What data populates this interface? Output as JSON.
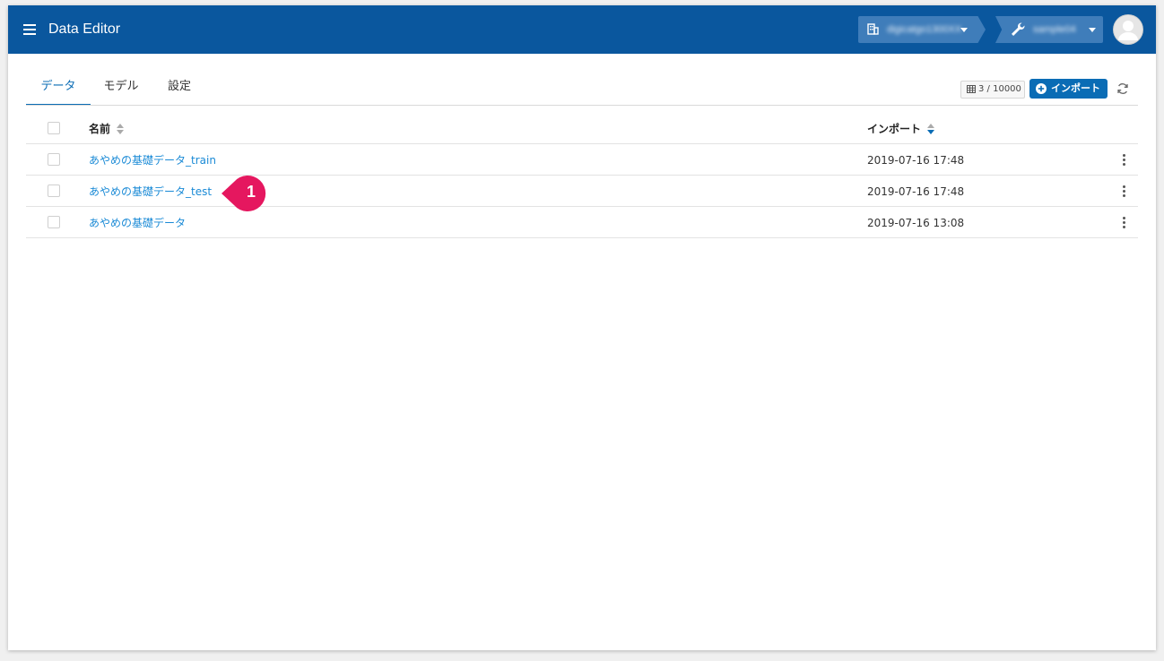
{
  "app": {
    "title": "Data Editor"
  },
  "header": {
    "organization": "digicatgo1300XX",
    "project": "sample04"
  },
  "tabs": [
    {
      "label": "データ",
      "active": true
    },
    {
      "label": "モデル",
      "active": false
    },
    {
      "label": "設定",
      "active": false
    }
  ],
  "toolbar": {
    "count": "3 / 10000",
    "import_label": "インポート"
  },
  "table": {
    "columns": {
      "name": "名前",
      "imported": "インポート"
    },
    "rows": [
      {
        "name": "あやめの基礎データ_train",
        "imported": "2019-07-16 17:48"
      },
      {
        "name": "あやめの基礎データ_test",
        "imported": "2019-07-16 17:48"
      },
      {
        "name": "あやめの基礎データ",
        "imported": "2019-07-16 13:08"
      }
    ]
  },
  "callout": {
    "number": "1",
    "color": "#e5175f"
  },
  "colors": {
    "appbar": "#0a579e",
    "accent": "#0a6cb5",
    "link": "#1a8ad6"
  }
}
